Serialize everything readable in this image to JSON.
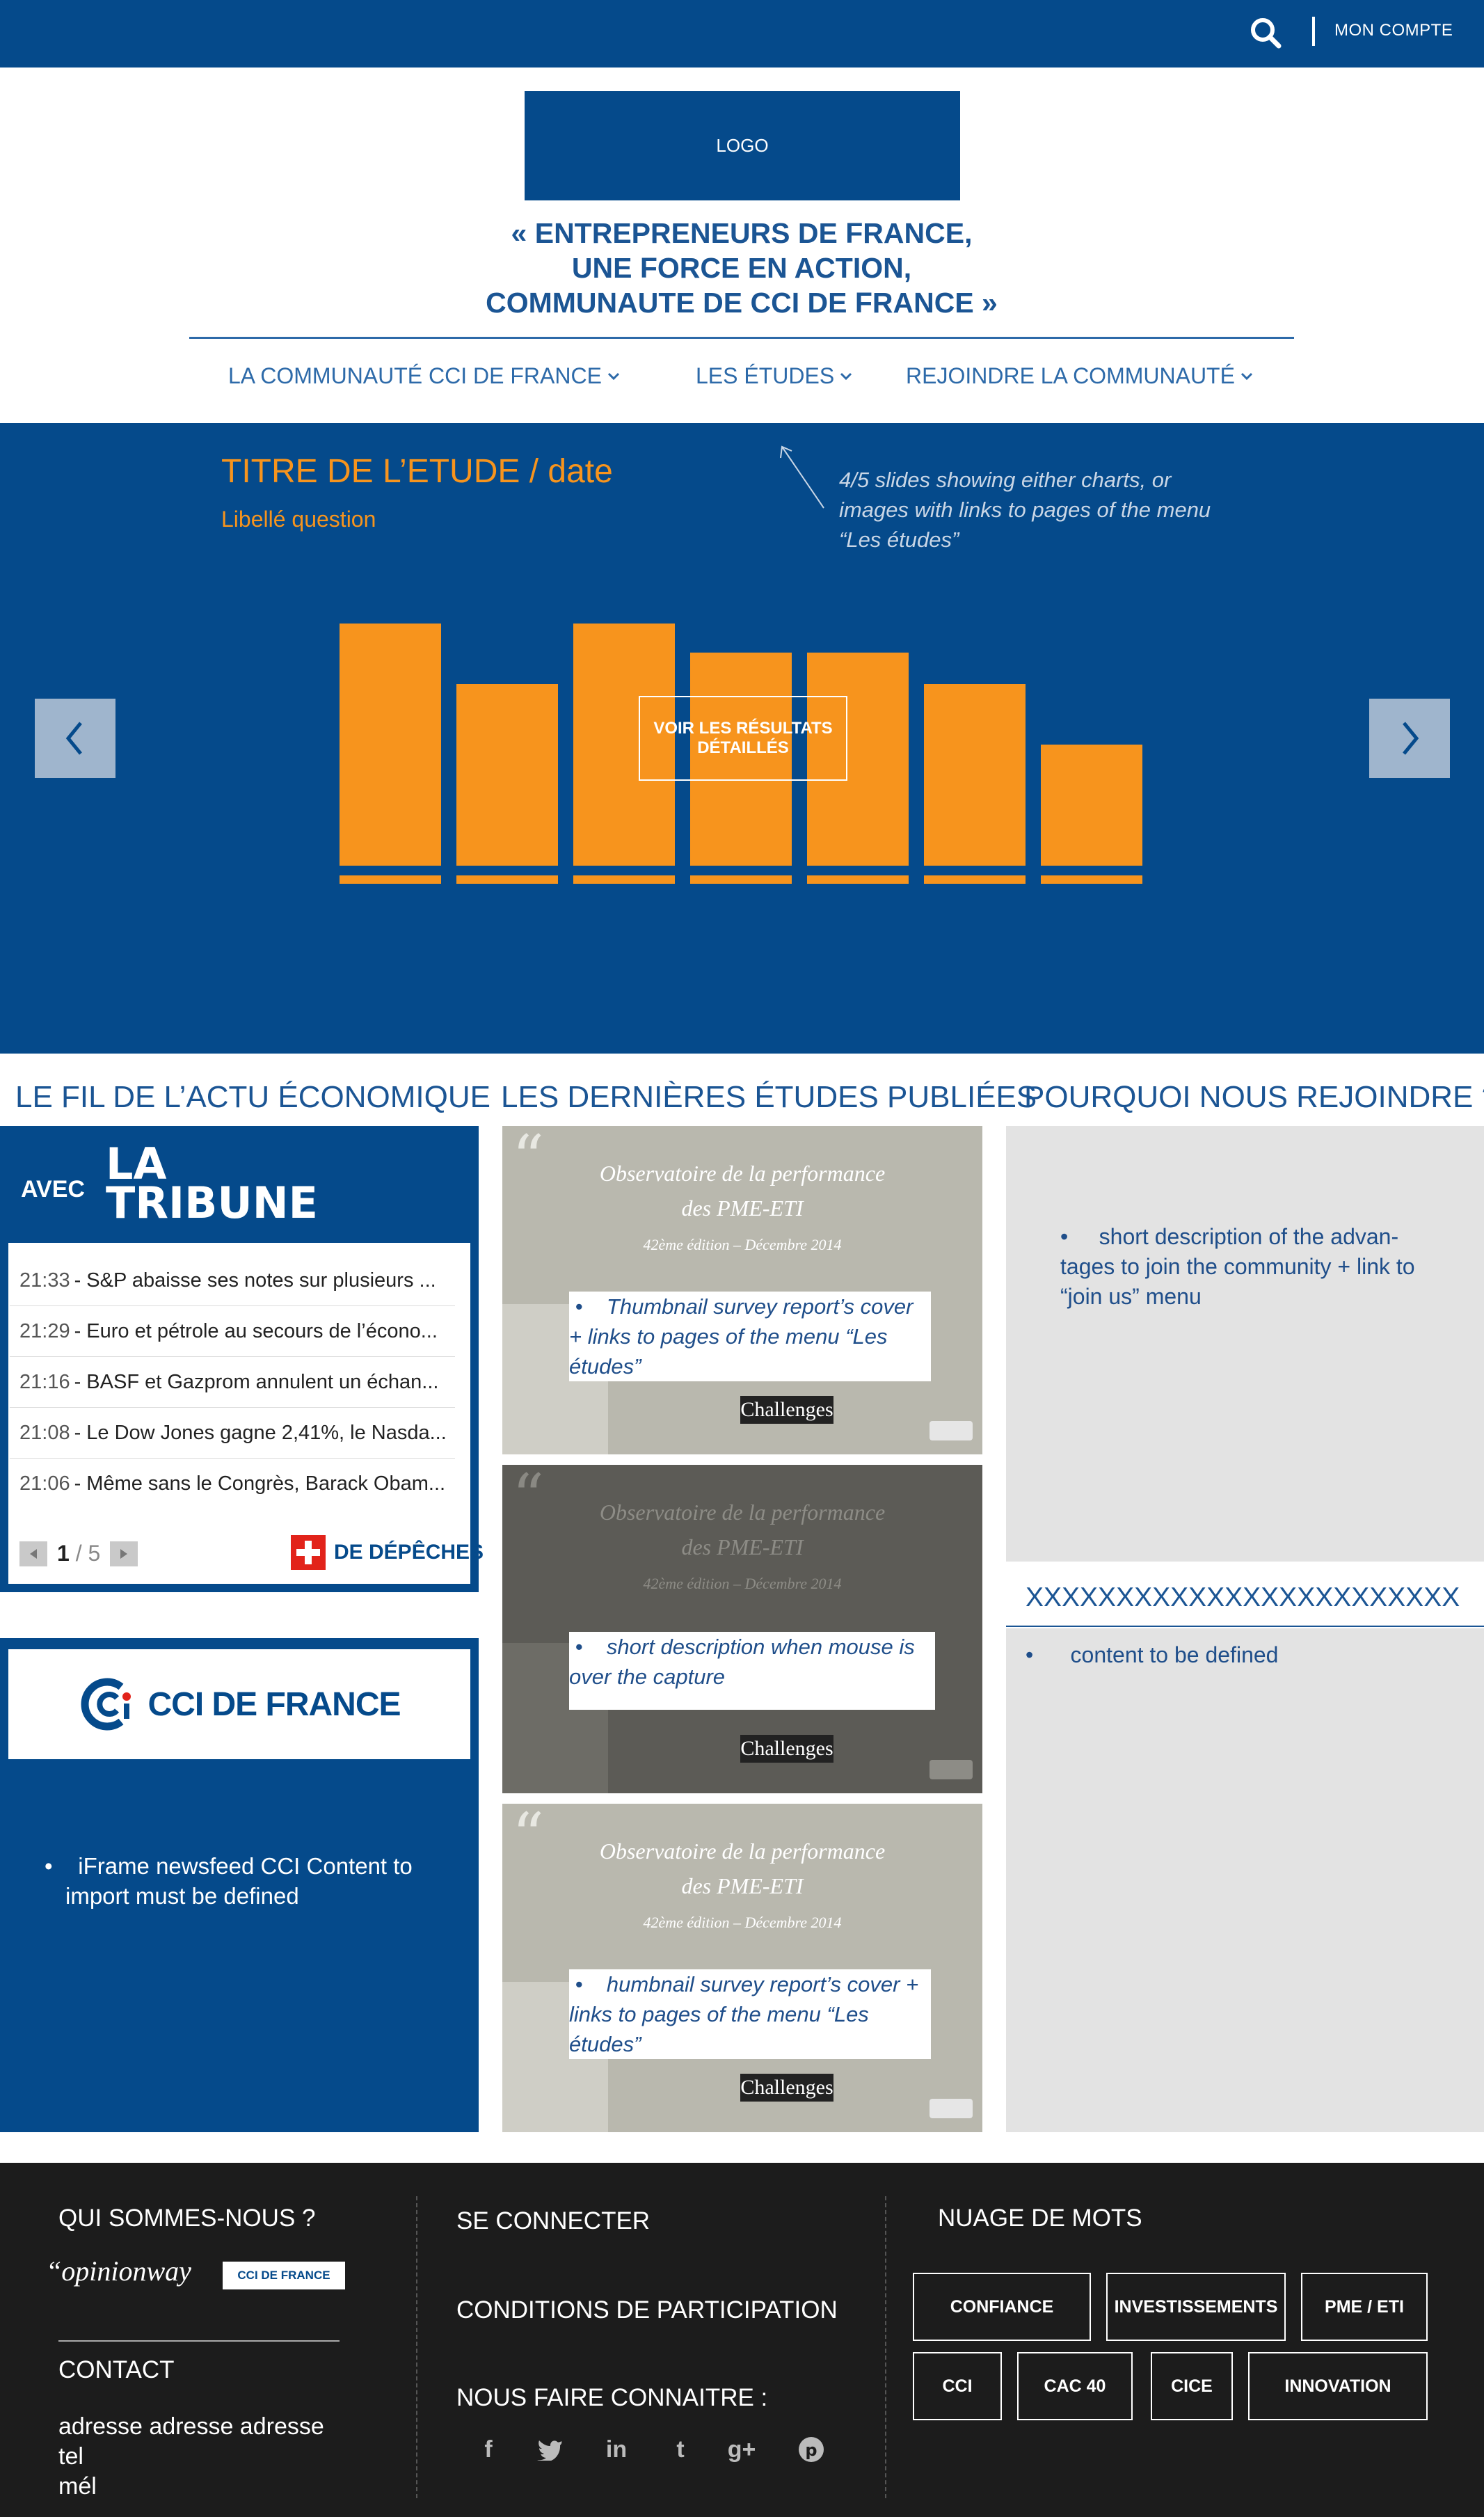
{
  "topbar": {
    "account_label": "MON COMPTE"
  },
  "header": {
    "logo_label": "LOGO",
    "tagline": [
      "« ENTREPRENEURS DE FRANCE,",
      "UNE FORCE EN ACTION,",
      "COMMUNAUTE DE CCI DE FRANCE »"
    ],
    "nav": [
      "LA COMMUNAUTÉ CCI DE FRANCE",
      "LES ÉTUDES",
      "REJOINDRE LA COMMUNAUTÉ"
    ]
  },
  "hero": {
    "title": "TITRE DE L’ETUDE / date",
    "question": "Libellé question",
    "annotation": "4/5 slides showing either charts, or images with links to pages of the menu “Les études”",
    "button_label": "VOIR LES RÉSULTATS DÉTAILLÉS"
  },
  "chart_data": {
    "type": "bar",
    "categories": [
      "",
      "",
      "",
      "",
      "",
      "",
      ""
    ],
    "values": [
      100,
      75,
      100,
      88,
      88,
      75,
      50
    ],
    "ylim": [
      0,
      100
    ],
    "color": "#f7941d"
  },
  "columns": {
    "news_heading": "LE FIL DE L’ACTU ÉCONOMIQUE",
    "studies_heading": "LES DERNIÈRES ÉTUDES PUBLIÉES",
    "join_heading": "POURQUOI NOUS REJOINDRE ?"
  },
  "tribune": {
    "avec": "AVEC",
    "logo_line1": "LA",
    "logo_line2": "TRIBUNE",
    "news": [
      {
        "time": "21:33",
        "text": "S&P abaisse ses notes sur plusieurs ..."
      },
      {
        "time": "21:29",
        "text": "Euro et pétrole au secours de l’écono..."
      },
      {
        "time": "21:16",
        "text": "BASF et Gazprom annulent un échan..."
      },
      {
        "time": "21:08",
        "text": "Le Dow Jones gagne 2,41%, le Nasda..."
      },
      {
        "time": "21:06",
        "text": "Même sans le Congrès, Barack Obam..."
      }
    ],
    "page_current": "1",
    "page_total": "/ 5",
    "depeches_label": "DE DÉPÊCHES"
  },
  "cci": {
    "logo_text": "CCI DE FRANCE",
    "bullet": "iFrame newsfeed CCI Content to import must be defined"
  },
  "thumbs": [
    {
      "title1": "Observatoire de la performance",
      "title2": "des PME-ETI",
      "edition": "42ème édition – Décembre 2014",
      "caption": "Thumbnail survey report’s cover + links to pages of the menu “Les études”",
      "brand": "Challenges"
    },
    {
      "title1": "Observatoire de la performance",
      "title2": "des PME-ETI",
      "edition": "42ème édition – Décembre 2014",
      "caption": "short description when mouse is over the capture",
      "brand": "Challenges"
    },
    {
      "title1": "Observatoire de la performance",
      "title2": "des PME-ETI",
      "edition": "42ème édition – Décembre 2014",
      "caption": "humbnail survey report’s cover + links to pages of the menu “Les études”",
      "brand": "Challenges"
    }
  ],
  "join": {
    "text": "short description of the advan-tages to join the community + link to “join us” menu",
    "xx_heading": "XXXXXXXXXXXXXXXXXXXXXXXX",
    "content": "content to be defined"
  },
  "footer": {
    "who": "QUI SOMMES-NOUS ?",
    "opinionway": "“opinionway",
    "cci_mini": "CCI DE FRANCE",
    "contact": "CONTACT",
    "address": "adresse adresse adresse",
    "tel": "tel",
    "mail": "mél",
    "connect": "SE CONNECTER",
    "conditions": "CONDITIONS DE PARTICIPATION",
    "share": "NOUS FAIRE CONNAITRE :",
    "cloud_title": "NUAGE DE MOTS",
    "tags": [
      "CONFIANCE",
      "INVESTISSEMENTS",
      "PME / ETI",
      "CCI",
      "CAC 40",
      "CICE",
      "INNOVATION"
    ]
  },
  "icons": {
    "facebook": "f",
    "twitter": "t",
    "linkedin": "in",
    "tumblr": "t",
    "googleplus": "g+",
    "pinterest": "p"
  }
}
